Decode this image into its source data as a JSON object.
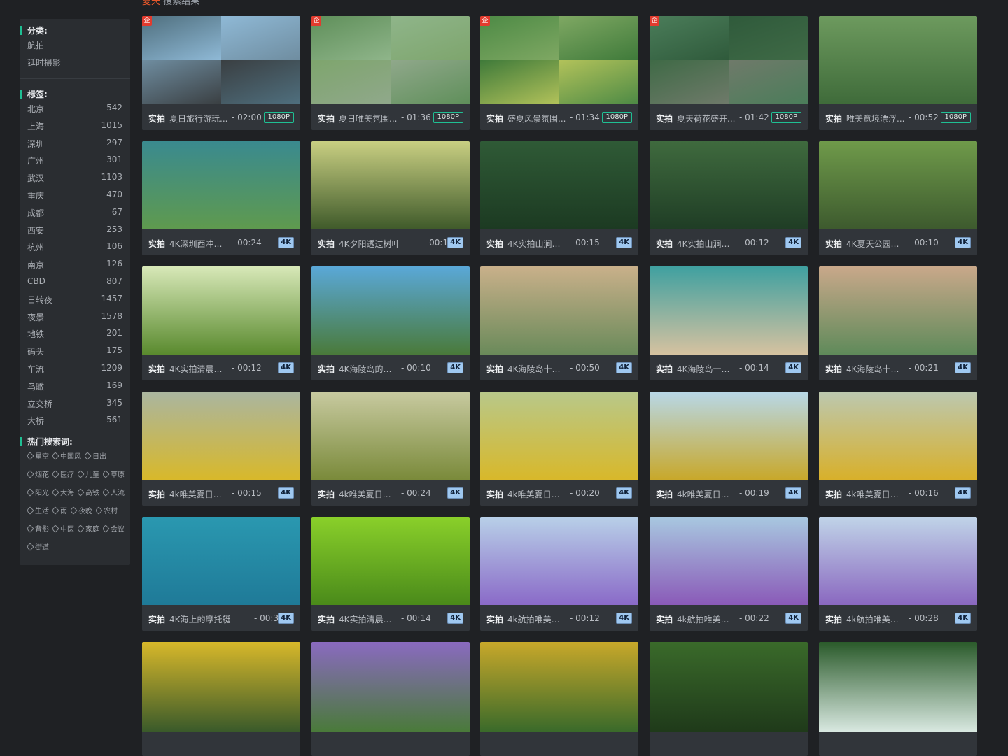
{
  "search_header": {
    "keyword": "夏天",
    "suffix": "搜索结果",
    "count": ""
  },
  "sidebar": {
    "category_title": "分类:",
    "categories": [
      "航拍",
      "延时摄影"
    ],
    "tag_title": "标签:",
    "tags": [
      {
        "name": "北京",
        "count": "542"
      },
      {
        "name": "上海",
        "count": "1015"
      },
      {
        "name": "深圳",
        "count": "297"
      },
      {
        "name": "广州",
        "count": "301"
      },
      {
        "name": "武汉",
        "count": "1103"
      },
      {
        "name": "重庆",
        "count": "470"
      },
      {
        "name": "成都",
        "count": "67"
      },
      {
        "name": "西安",
        "count": "253"
      },
      {
        "name": "杭州",
        "count": "106"
      },
      {
        "name": "南京",
        "count": "126"
      },
      {
        "name": "CBD",
        "count": "807"
      },
      {
        "name": "日转夜",
        "count": "1457"
      },
      {
        "name": "夜景",
        "count": "1578"
      },
      {
        "name": "地铁",
        "count": "201"
      },
      {
        "name": "码头",
        "count": "175"
      },
      {
        "name": "车流",
        "count": "1209"
      },
      {
        "name": "鸟瞰",
        "count": "169"
      },
      {
        "name": "立交桥",
        "count": "345"
      },
      {
        "name": "大桥",
        "count": "561"
      }
    ],
    "hot_title": "热门搜索词:",
    "hot_keywords": [
      [
        "星空",
        "中国风",
        "日出"
      ],
      [
        "烟花",
        "医疗",
        "儿童",
        "草原"
      ],
      [
        "阳光",
        "大海",
        "高铁",
        "人流"
      ],
      [
        "生活",
        "雨",
        "夜晚",
        "农村"
      ],
      [
        "背影",
        "中医",
        "家庭",
        "会议"
      ],
      [
        "街道"
      ]
    ]
  },
  "qi_badge": "企",
  "shi_label": "实拍",
  "videos": [
    {
      "title": "夏日旅行游玩...",
      "dur": "- 02:00",
      "res": "1080P",
      "qi": true,
      "colors": [
        "#4f6f7e",
        "#8fb9d6",
        "#6f8da0",
        "#3a3f42"
      ],
      "mosaic": true
    },
    {
      "title": "夏日唯美氛围...",
      "dur": "- 01:36",
      "res": "1080P",
      "qi": true,
      "colors": [
        "#5f8f5a",
        "#8fb58a",
        "#7ea56d",
        "#90a88b"
      ],
      "mosaic": true
    },
    {
      "title": "盛夏风景氛围...",
      "dur": "- 01:34",
      "res": "1080P",
      "qi": true,
      "colors": [
        "#4d8a45",
        "#7fa863",
        "#3f7a3a",
        "#b2c25a"
      ],
      "mosaic": true
    },
    {
      "title": "夏天荷花盛开...",
      "dur": "- 01:42",
      "res": "1080P",
      "qi": true,
      "colors": [
        "#4b7d5a",
        "#2f5a3b",
        "#3f6a46",
        "#6f7a6a"
      ],
      "mosaic": true
    },
    {
      "title": "唯美意境漂浮...",
      "dur": "- 00:52",
      "res": "1080P",
      "qi": false,
      "colors": [
        "#6d9a5e",
        "#3f6b3a"
      ],
      "mosaic": false
    },
    {
      "title": "4K深圳西冲海...",
      "dur": "- 00:24",
      "res": "4K",
      "qi": false,
      "colors": [
        "#3a8a8f",
        "#5f9a4e"
      ],
      "mosaic": false
    },
    {
      "title": "4K夕阳透过树叶",
      "dur": "- 00:10",
      "res": "4K",
      "qi": false,
      "colors": [
        "#c9cf82",
        "#3f5a2a"
      ],
      "mosaic": false,
      "wide": true
    },
    {
      "title": "4K实拍山涧溪...",
      "dur": "- 00:15",
      "res": "4K",
      "qi": false,
      "colors": [
        "#2f5a36",
        "#1c3a22"
      ],
      "mosaic": false
    },
    {
      "title": "4K实拍山涧溪...",
      "dur": "- 00:12",
      "res": "4K",
      "qi": false,
      "colors": [
        "#3f6a3e",
        "#1f3d25"
      ],
      "mosaic": false
    },
    {
      "title": "4K夏天公园里...",
      "dur": "- 00:10",
      "res": "4K",
      "qi": false,
      "colors": [
        "#6f9a4a",
        "#3d5a2e"
      ],
      "mosaic": false
    },
    {
      "title": "4K实拍清晨稻...",
      "dur": "- 00:12",
      "res": "4K",
      "qi": false,
      "colors": [
        "#d8e8b8",
        "#5a8a2e"
      ],
      "mosaic": false
    },
    {
      "title": "4K海陵岛的积...",
      "dur": "- 00:10",
      "res": "4K",
      "qi": false,
      "colors": [
        "#5aa8d8",
        "#4a7a3a"
      ],
      "mosaic": false
    },
    {
      "title": "4K海陵岛十里...",
      "dur": "- 00:50",
      "res": "4K",
      "qi": false,
      "colors": [
        "#c9b08a",
        "#6a8a5a"
      ],
      "mosaic": false
    },
    {
      "title": "4K海陵岛十里...",
      "dur": "- 00:14",
      "res": "4K",
      "qi": false,
      "colors": [
        "#3fa0a0",
        "#d6c2a0"
      ],
      "mosaic": false
    },
    {
      "title": "4K海陵岛十里...",
      "dur": "- 00:21",
      "res": "4K",
      "qi": false,
      "colors": [
        "#c9a88a",
        "#5f8a5a"
      ],
      "mosaic": false
    },
    {
      "title": "4k唯美夏日向...",
      "dur": "- 00:15",
      "res": "4K",
      "qi": false,
      "colors": [
        "#aab6a0",
        "#d8b82a"
      ],
      "mosaic": false
    },
    {
      "title": "4k唯美夏日向...",
      "dur": "- 00:24",
      "res": "4K",
      "qi": false,
      "colors": [
        "#c8caa0",
        "#7a8a3a"
      ],
      "mosaic": false
    },
    {
      "title": "4k唯美夏日向...",
      "dur": "- 00:20",
      "res": "4K",
      "qi": false,
      "colors": [
        "#b8c88a",
        "#d8b82a"
      ],
      "mosaic": false
    },
    {
      "title": "4k唯美夏日向...",
      "dur": "- 00:19",
      "res": "4K",
      "qi": false,
      "colors": [
        "#b8d8e8",
        "#c8a82a"
      ],
      "mosaic": false
    },
    {
      "title": "4k唯美夏日向...",
      "dur": "- 00:16",
      "res": "4K",
      "qi": false,
      "colors": [
        "#bcc8b0",
        "#d8b02a"
      ],
      "mosaic": false
    },
    {
      "title": "4K海上的摩托艇",
      "dur": "- 00:31",
      "res": "4K",
      "qi": false,
      "colors": [
        "#2a98b0",
        "#1f7a98"
      ],
      "mosaic": false,
      "wide": true
    },
    {
      "title": "4K实拍清晨水...",
      "dur": "- 00:14",
      "res": "4K",
      "qi": false,
      "colors": [
        "#8ad02a",
        "#4a8a1a"
      ],
      "mosaic": false
    },
    {
      "title": "4k航拍唯美薰...",
      "dur": "- 00:12",
      "res": "4K",
      "qi": false,
      "colors": [
        "#b8d0e8",
        "#8a6ac8"
      ],
      "mosaic": false
    },
    {
      "title": "4k航拍唯美薰...",
      "dur": "- 00:22",
      "res": "4K",
      "qi": false,
      "colors": [
        "#a8c8e0",
        "#8a5ab8"
      ],
      "mosaic": false
    },
    {
      "title": "4k航拍唯美薰...",
      "dur": "- 00:28",
      "res": "4K",
      "qi": false,
      "colors": [
        "#c0d4e8",
        "#8a68c0"
      ],
      "mosaic": false
    },
    {
      "thumb_only": true,
      "colors": [
        "#d8b82a",
        "#3a5a2a"
      ]
    },
    {
      "thumb_only": true,
      "colors": [
        "#8a6ac0",
        "#4a7a3a"
      ]
    },
    {
      "thumb_only": true,
      "colors": [
        "#c8a82a",
        "#3a6a2a"
      ]
    },
    {
      "thumb_only": true,
      "colors": [
        "#3a6a2a",
        "#1f3a1a"
      ]
    },
    {
      "thumb_only": true,
      "colors": [
        "#2a5a2a",
        "#d8e8e0"
      ]
    }
  ]
}
